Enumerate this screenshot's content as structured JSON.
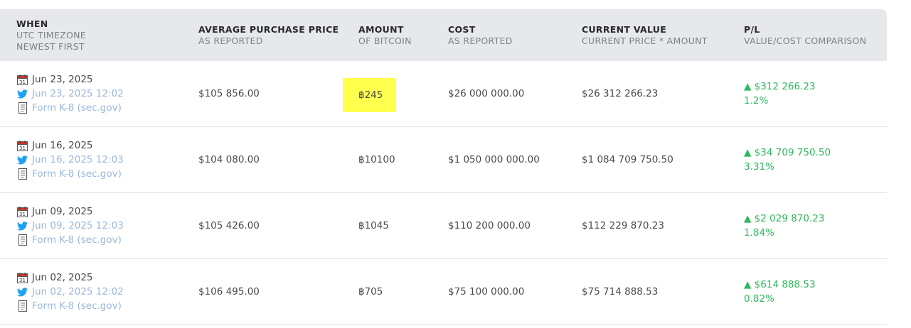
{
  "colors": {
    "header_bg": "#e6e8eb",
    "link": "#9ab7dc",
    "gain": "#2eb85c",
    "highlight": "#ffff4d"
  },
  "headers": {
    "when": {
      "title": "WHEN",
      "sub1": "UTC TIMEZONE",
      "sub2": "NEWEST FIRST"
    },
    "avg_price": {
      "title": "AVERAGE PURCHASE PRICE",
      "sub": "AS REPORTED"
    },
    "amount": {
      "title": "AMOUNT",
      "sub": "OF BITCOIN"
    },
    "cost": {
      "title": "COST",
      "sub": "AS REPORTED"
    },
    "current_value": {
      "title": "CURRENT VALUE",
      "sub": "CURRENT PRICE * AMOUNT"
    },
    "pl": {
      "title": "P/L",
      "sub": "VALUE/COST COMPARISON"
    }
  },
  "rows": [
    {
      "date": "Jun 23, 2025",
      "tweet": "Jun 23, 2025 12:02",
      "filing": "Form K-8 (sec.gov)",
      "avg_price": "$105 856.00",
      "amount": "฿245",
      "cost": "$26 000 000.00",
      "current_value": "$26 312 266.23",
      "pl_amount": "▲ $312 266.23",
      "pl_percent": "1.2%"
    },
    {
      "date": "Jun 16, 2025",
      "tweet": "Jun 16, 2025 12:03",
      "filing": "Form K-8 (sec.gov)",
      "avg_price": "$104 080.00",
      "amount": "฿10100",
      "cost": "$1 050 000 000.00",
      "current_value": "$1 084 709 750.50",
      "pl_amount": "▲ $34 709 750.50",
      "pl_percent": "3.31%"
    },
    {
      "date": "Jun 09, 2025",
      "tweet": "Jun 09, 2025 12:03",
      "filing": "Form K-8 (sec.gov)",
      "avg_price": "$105 426.00",
      "amount": "฿1045",
      "cost": "$110 200 000.00",
      "current_value": "$112 229 870.23",
      "pl_amount": "▲ $2 029 870.23",
      "pl_percent": "1.84%"
    },
    {
      "date": "Jun 02, 2025",
      "tweet": "Jun 02, 2025 12:02",
      "filing": "Form K-8 (sec.gov)",
      "avg_price": "$106 495.00",
      "amount": "฿705",
      "cost": "$75 100 000.00",
      "current_value": "$75 714 888.53",
      "pl_amount": "▲ $614 888.53",
      "pl_percent": "0.82%"
    }
  ],
  "icons": {
    "date": "calendar-icon",
    "tweet": "twitter-icon",
    "filing": "document-icon"
  }
}
